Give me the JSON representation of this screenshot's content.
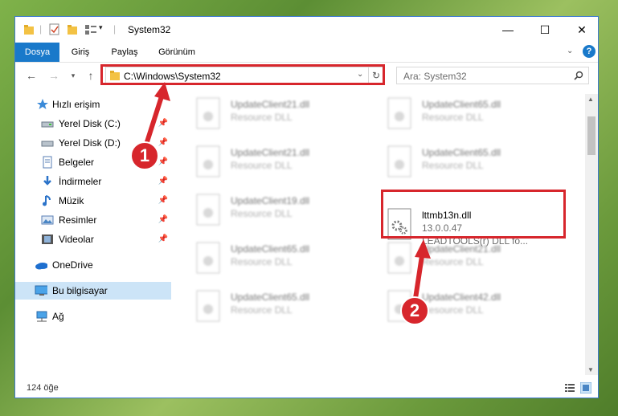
{
  "window": {
    "title": "System32"
  },
  "ribbon": {
    "tabs": [
      "Dosya",
      "Giriş",
      "Paylaş",
      "Görünüm"
    ]
  },
  "address": {
    "path": "C:\\Windows\\System32"
  },
  "search": {
    "placeholder": "Ara: System32"
  },
  "sidebar": {
    "items": [
      {
        "label": "Hızlı erişim",
        "icon": "star-icon"
      },
      {
        "label": "Yerel Disk (C:)",
        "icon": "drive-icon"
      },
      {
        "label": "Yerel Disk (D:)",
        "icon": "drive-icon"
      },
      {
        "label": "Belgeler",
        "icon": "documents-icon"
      },
      {
        "label": "İndirmeler",
        "icon": "download-icon"
      },
      {
        "label": "Müzik",
        "icon": "music-icon"
      },
      {
        "label": "Resimler",
        "icon": "pictures-icon"
      },
      {
        "label": "Videolar",
        "icon": "video-icon"
      },
      {
        "label": "OneDrive",
        "icon": "cloud-icon"
      },
      {
        "label": "Bu bilgisayar",
        "icon": "computer-icon"
      },
      {
        "label": "Ağ",
        "icon": "network-icon"
      }
    ]
  },
  "files": {
    "col1": [
      {
        "name": "UpdateClient21.dll",
        "desc": "Resource DLL"
      },
      {
        "name": "UpdateClient21.dll",
        "desc": "Resource DLL"
      },
      {
        "name": "UpdateClient19.dll",
        "desc": "Resource DLL"
      },
      {
        "name": "UpdateClient65.dll",
        "desc": "Resource DLL"
      },
      {
        "name": "UpdateClient65.dll",
        "desc": "Resource DLL"
      }
    ],
    "col2": [
      {
        "name": "UpdateClient65.dll",
        "desc": "Resource DLL"
      },
      {
        "name": "UpdateClient65.dll",
        "desc": "Resource DLL"
      },
      {
        "name": "UpdateClient21.dll",
        "desc": "Resource DLL"
      },
      {
        "name": "UpdateClient42.dll",
        "desc": "Resource DLL"
      }
    ],
    "highlighted": {
      "name": "lttmb13n.dll",
      "version": "13.0.0.47",
      "desc": "LEADTOOLS(r) DLL fo..."
    }
  },
  "status": {
    "count": "124 öğe"
  },
  "annotations": {
    "badge1": "1",
    "badge2": "2"
  },
  "colors": {
    "accent": "#1979ca",
    "highlight": "#d7262c"
  }
}
